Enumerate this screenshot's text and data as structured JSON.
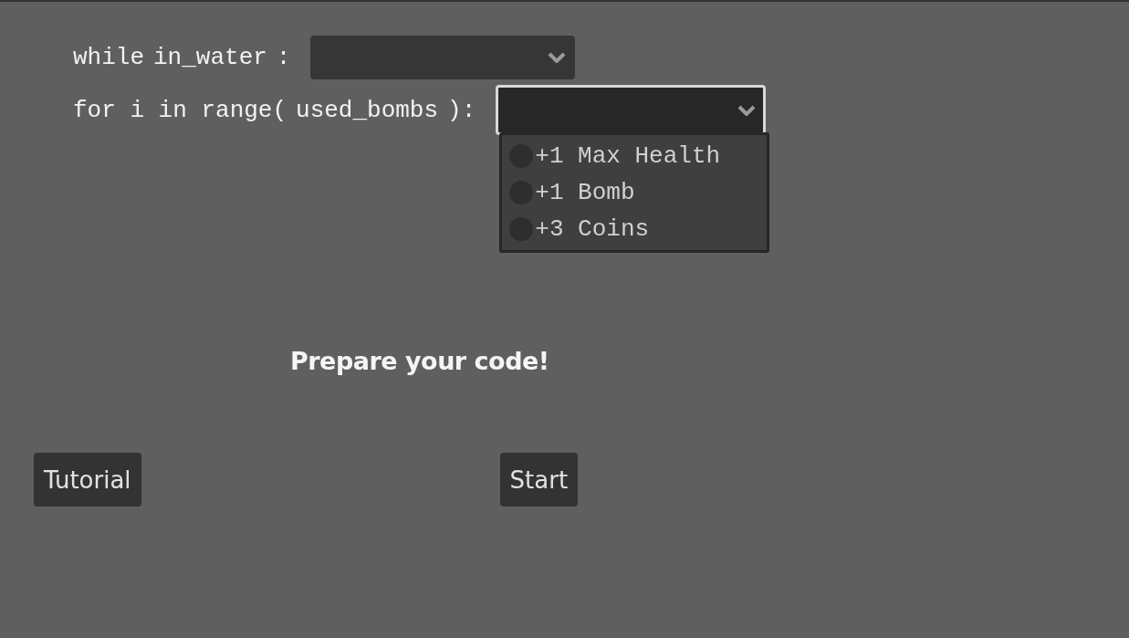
{
  "code_lines": [
    {
      "segments": [
        "while",
        "in_water",
        ":"
      ],
      "dropdown": {
        "expanded": false
      }
    },
    {
      "segments": [
        "for i in range(",
        "used_bombs",
        "):"
      ],
      "dropdown": {
        "expanded": true,
        "options": [
          {
            "label": "+1 Max Health",
            "selected": false
          },
          {
            "label": "+1 Bomb",
            "selected": false
          },
          {
            "label": "+3 Coins",
            "selected": false
          }
        ]
      }
    }
  ],
  "message": "Prepare your code!",
  "buttons": [
    {
      "label": "Tutorial"
    },
    {
      "label": "Start"
    }
  ]
}
